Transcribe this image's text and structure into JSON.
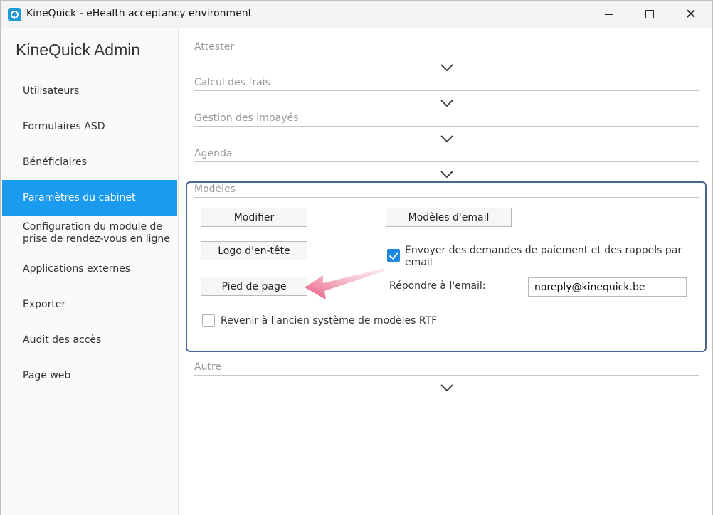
{
  "window": {
    "title": "KineQuick - eHealth acceptancy environment",
    "close_glyph": "✕"
  },
  "sidebar": {
    "title": "KineQuick Admin",
    "items": [
      {
        "label": "Utilisateurs"
      },
      {
        "label": "Formulaires ASD"
      },
      {
        "label": "Bénéficiaires"
      },
      {
        "label": "Paramètres du cabinet"
      },
      {
        "label": "Configuration du module de prise de rendez-vous en ligne"
      },
      {
        "label": "Applications externes"
      },
      {
        "label": "Exporter"
      },
      {
        "label": "Audit des accès"
      },
      {
        "label": "Page web"
      }
    ],
    "active_color": "#1a9bf0"
  },
  "sections": [
    {
      "label": "Attester"
    },
    {
      "label": "Calcul des frais"
    },
    {
      "label": "Gestion des impayés"
    },
    {
      "label": "Agenda"
    },
    {
      "label": "Modèles"
    },
    {
      "label": "Autre"
    }
  ],
  "modeles": {
    "modifier_label": "Modifier",
    "logo_label": "Logo d'en-tête",
    "pied_label": "Pied de page",
    "email_models_label": "Modèles d'email",
    "send_requests_label": "Envoyer des demandes de paiement et des rappels par email",
    "send_requests_checked": true,
    "reply_label": "Répondre à l'email:",
    "reply_value": "noreply@kinequick.be",
    "rtf_label": "Revenir à l'ancien système de modèles RTF",
    "rtf_checked": false,
    "border_color": "#4a6591"
  },
  "annotation": {
    "arrow_color": "#e8537a"
  }
}
